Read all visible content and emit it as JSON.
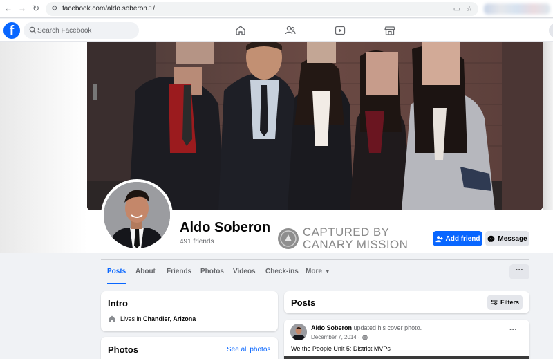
{
  "browser": {
    "url": "facebook.com/aldo.soberon.1/",
    "icons": [
      "back-arrow-icon",
      "forward-arrow-icon",
      "reload-icon",
      "site-settings-icon",
      "install-app-icon",
      "bookmark-star-icon"
    ]
  },
  "facebook": {
    "logo": "f",
    "search_placeholder": "Search Facebook",
    "nav_icons": [
      "home-icon",
      "friends-icon",
      "video-icon",
      "marketplace-icon"
    ]
  },
  "profile": {
    "name": "Aldo Soberon",
    "friends": "491 friends",
    "stamp_line1": "CAPTURED BY",
    "stamp_line2": "CANARY MISSION",
    "add_friend_label": "Add friend",
    "message_label": "Message"
  },
  "tabs": [
    {
      "label": "Posts",
      "active": true
    },
    {
      "label": "About"
    },
    {
      "label": "Friends"
    },
    {
      "label": "Photos"
    },
    {
      "label": "Videos"
    },
    {
      "label": "Check-ins"
    },
    {
      "label": "More"
    }
  ],
  "tab_more_button": "···",
  "intro": {
    "title": "Intro",
    "lives_prefix": "Lives in",
    "lives_place": "Chandler, Arizona"
  },
  "photos_card": {
    "title": "Photos",
    "see_all": "See all photos"
  },
  "posts": {
    "title": "Posts",
    "filters_label": "Filters",
    "item": {
      "author": "Aldo Soberon",
      "action": "updated his cover photo.",
      "date": "December 7, 2014 ·",
      "text": "We the People Unit 5: District MVPs",
      "more": "···"
    }
  },
  "colors": {
    "brand_blue": "#0866ff",
    "page_bg": "#f0f2f5",
    "secondary_button": "#e4e6eb"
  }
}
